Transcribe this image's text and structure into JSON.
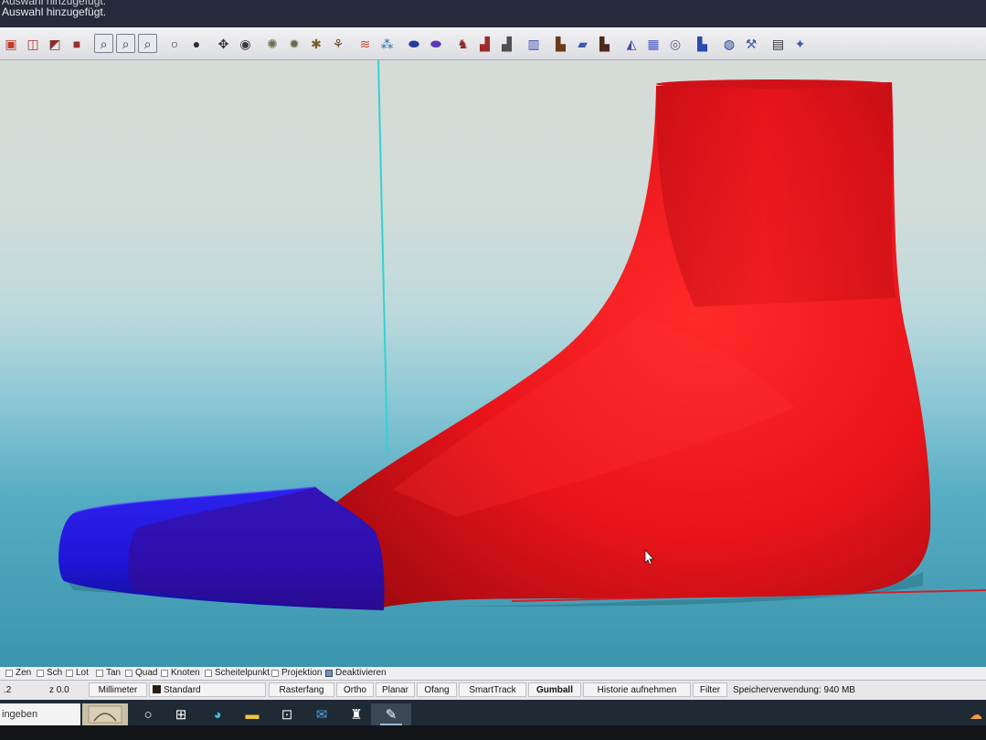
{
  "command_history": {
    "line1": "Auswahl hinzugefügt.",
    "line2": "Auswahl hinzugefügt."
  },
  "toolbar": {
    "icons": [
      {
        "name": "open-icon",
        "glyph": "▣",
        "color": "#c23a2b"
      },
      {
        "name": "box-mesh-icon",
        "glyph": "◫",
        "color": "#b0342a"
      },
      {
        "name": "box-shaded-icon",
        "glyph": "◩",
        "color": "#8a2f2a"
      },
      {
        "name": "box-render-icon",
        "glyph": "■",
        "color": "#9a2d2a"
      },
      {
        "name": "zoom-extents-icon",
        "glyph": "⌕",
        "color": "#303030",
        "selected": true,
        "gap": true
      },
      {
        "name": "zoom-window-icon",
        "glyph": "⌕",
        "color": "#303030",
        "selected": true
      },
      {
        "name": "zoom-selected-icon",
        "glyph": "⌕",
        "color": "#303030",
        "selected": true
      },
      {
        "name": "sphere-wire-icon",
        "glyph": "○",
        "color": "#333",
        "gap": true
      },
      {
        "name": "sphere-shaded-icon",
        "glyph": "●",
        "color": "#2a2a3a"
      },
      {
        "name": "move-icon",
        "glyph": "✥",
        "color": "#333",
        "gap": true
      },
      {
        "name": "hide-eye-icon",
        "glyph": "◉",
        "color": "#3a3a3a"
      },
      {
        "name": "light-bulb-icon",
        "glyph": "✺",
        "color": "#6a6a4a",
        "gap": true
      },
      {
        "name": "light-off-icon",
        "glyph": "✹",
        "color": "#6a6a4a"
      },
      {
        "name": "points-on-icon",
        "glyph": "✱",
        "color": "#7a5a2a"
      },
      {
        "name": "points-edit-icon",
        "glyph": "⚘",
        "color": "#6a4a2a"
      },
      {
        "name": "curve-blend-icon",
        "glyph": "≋",
        "color": "#c24a2a",
        "gap": true
      },
      {
        "name": "network-icon",
        "glyph": "⁂",
        "color": "#2a6ab0"
      },
      {
        "name": "insole-blue-icon",
        "glyph": "⬬",
        "color": "#2a3aa0",
        "gap": true
      },
      {
        "name": "insole-purple-icon",
        "glyph": "⬬",
        "color": "#5a3ab0"
      },
      {
        "name": "last-pair-icon",
        "glyph": "♞",
        "color": "#8a2a2a",
        "gap": true
      },
      {
        "name": "shoe-red-icon",
        "glyph": "▟",
        "color": "#a02a2a"
      },
      {
        "name": "shoe-grey-icon",
        "glyph": "▟",
        "color": "#505050"
      },
      {
        "name": "columns-icon",
        "glyph": "▥",
        "color": "#3a4ab0",
        "gap": true
      },
      {
        "name": "boot-brown-icon",
        "glyph": "▙",
        "color": "#6a3a1a",
        "gap": true
      },
      {
        "name": "sole-blue-icon",
        "glyph": "▰",
        "color": "#3a5ab0"
      },
      {
        "name": "boot-dark-icon",
        "glyph": "▙",
        "color": "#4a2a1a"
      },
      {
        "name": "bag-icon",
        "glyph": "◭",
        "color": "#3a4ab0",
        "gap": true
      },
      {
        "name": "grid-shoe-icon",
        "glyph": "▦",
        "color": "#4a5ac0"
      },
      {
        "name": "stack-icon",
        "glyph": "◎",
        "color": "#5a5a7a"
      },
      {
        "name": "sock-icon",
        "glyph": "▙",
        "color": "#2a4ab0",
        "gap": true
      },
      {
        "name": "globe-icon",
        "glyph": "◍",
        "color": "#1a3a8a",
        "gap": true
      },
      {
        "name": "wrench-icon",
        "glyph": "⚒",
        "color": "#3a5ab0"
      },
      {
        "name": "book-icon",
        "glyph": "▤",
        "color": "#303030",
        "gap": true
      },
      {
        "name": "satellite-icon",
        "glyph": "✦",
        "color": "#3a5ab0"
      }
    ]
  },
  "osnap": {
    "items": [
      {
        "label": "Zen",
        "checked": false
      },
      {
        "label": "Sch",
        "checked": false
      },
      {
        "label": "Lot",
        "checked": false
      },
      {
        "label": "Tan",
        "checked": false
      },
      {
        "label": "Quad",
        "checked": false
      },
      {
        "label": "Knoten",
        "checked": false
      },
      {
        "label": "Scheitelpunkt",
        "checked": false
      },
      {
        "label": "Projektion",
        "checked": false
      },
      {
        "label": "Deaktivieren",
        "checked": true
      }
    ]
  },
  "status": {
    "coord_y": ".2",
    "coord_z": "z 0.0",
    "units": "Millimeter",
    "layer": "Standard",
    "layer_color": "#2b1c10",
    "buttons": {
      "raster": "Rasterfang",
      "ortho": "Ortho",
      "planar": "Planar",
      "ofang": "Ofang",
      "smarttrack": "SmartTrack",
      "gumball": "Gumball",
      "history": "Historie aufnehmen",
      "filter": "Filter"
    },
    "memory": "Speicherverwendung: 940 MB"
  },
  "taskbar": {
    "search_text": "ingeben"
  },
  "colors": {
    "foot": "#e8141a",
    "toe_cap": "#1f16d8",
    "axis_green": "#33d2d2",
    "axis_red": "#d81e2a"
  }
}
